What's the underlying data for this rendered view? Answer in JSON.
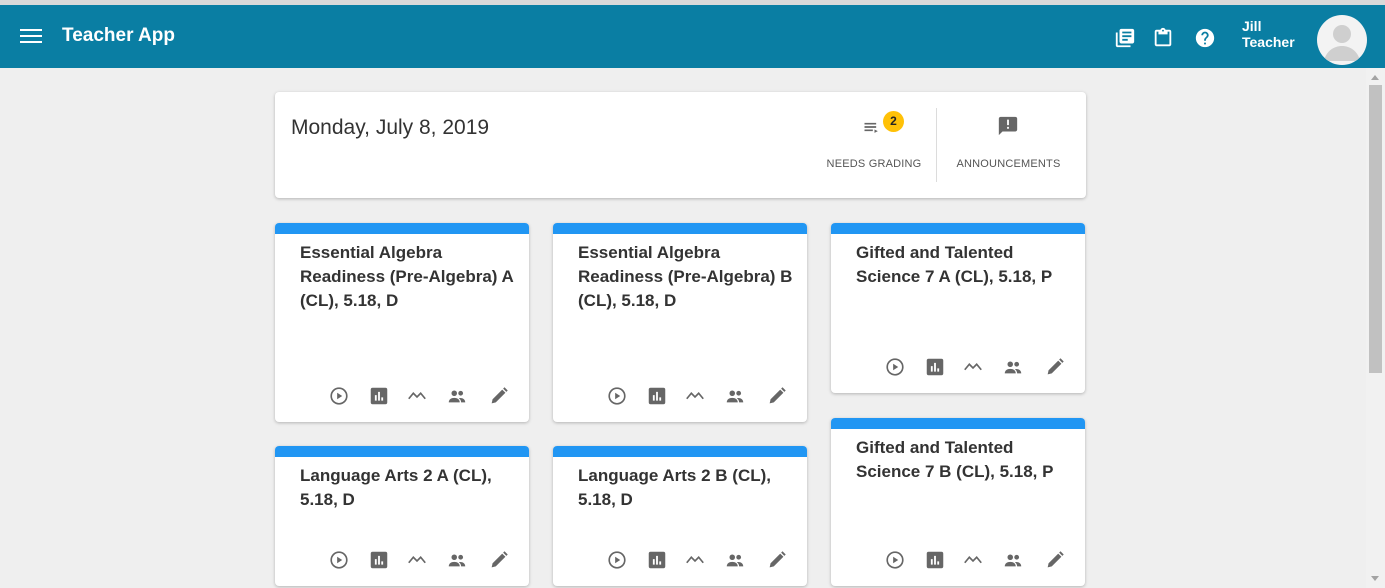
{
  "header": {
    "app_title": "Teacher App",
    "user_first": "Jill",
    "user_last": "Teacher",
    "color": "#0a7ea3",
    "icons": [
      "menu-icon",
      "library-books-icon",
      "clipboard-icon",
      "help-icon",
      "avatar-icon"
    ]
  },
  "summary": {
    "date": "Monday, July 8, 2019",
    "needs_grading_label": "NEEDS GRADING",
    "needs_grading_count": "2",
    "announcements_label": "ANNOUNCEMENTS"
  },
  "courses": [
    {
      "title": "Essential Algebra Readiness (Pre-Algebra) A (CL), 5.18, D"
    },
    {
      "title": "Essential Algebra Readiness (Pre-Algebra) B (CL), 5.18, D"
    },
    {
      "title": "Gifted and Talented Science 7 A (CL), 5.18, P"
    },
    {
      "title": "Language Arts 2 A (CL), 5.18, D"
    },
    {
      "title": "Language Arts 2 B (CL), 5.18, D"
    },
    {
      "title": "Gifted and Talented Science 7 B (CL), 5.18, P"
    }
  ],
  "course_action_icons": [
    "play-circle-icon",
    "bar-chart-icon",
    "trending-icon",
    "people-icon",
    "edit-icon"
  ],
  "colors": {
    "stripe": "#2196f3",
    "badge": "#ffc107",
    "background": "#efefef"
  }
}
